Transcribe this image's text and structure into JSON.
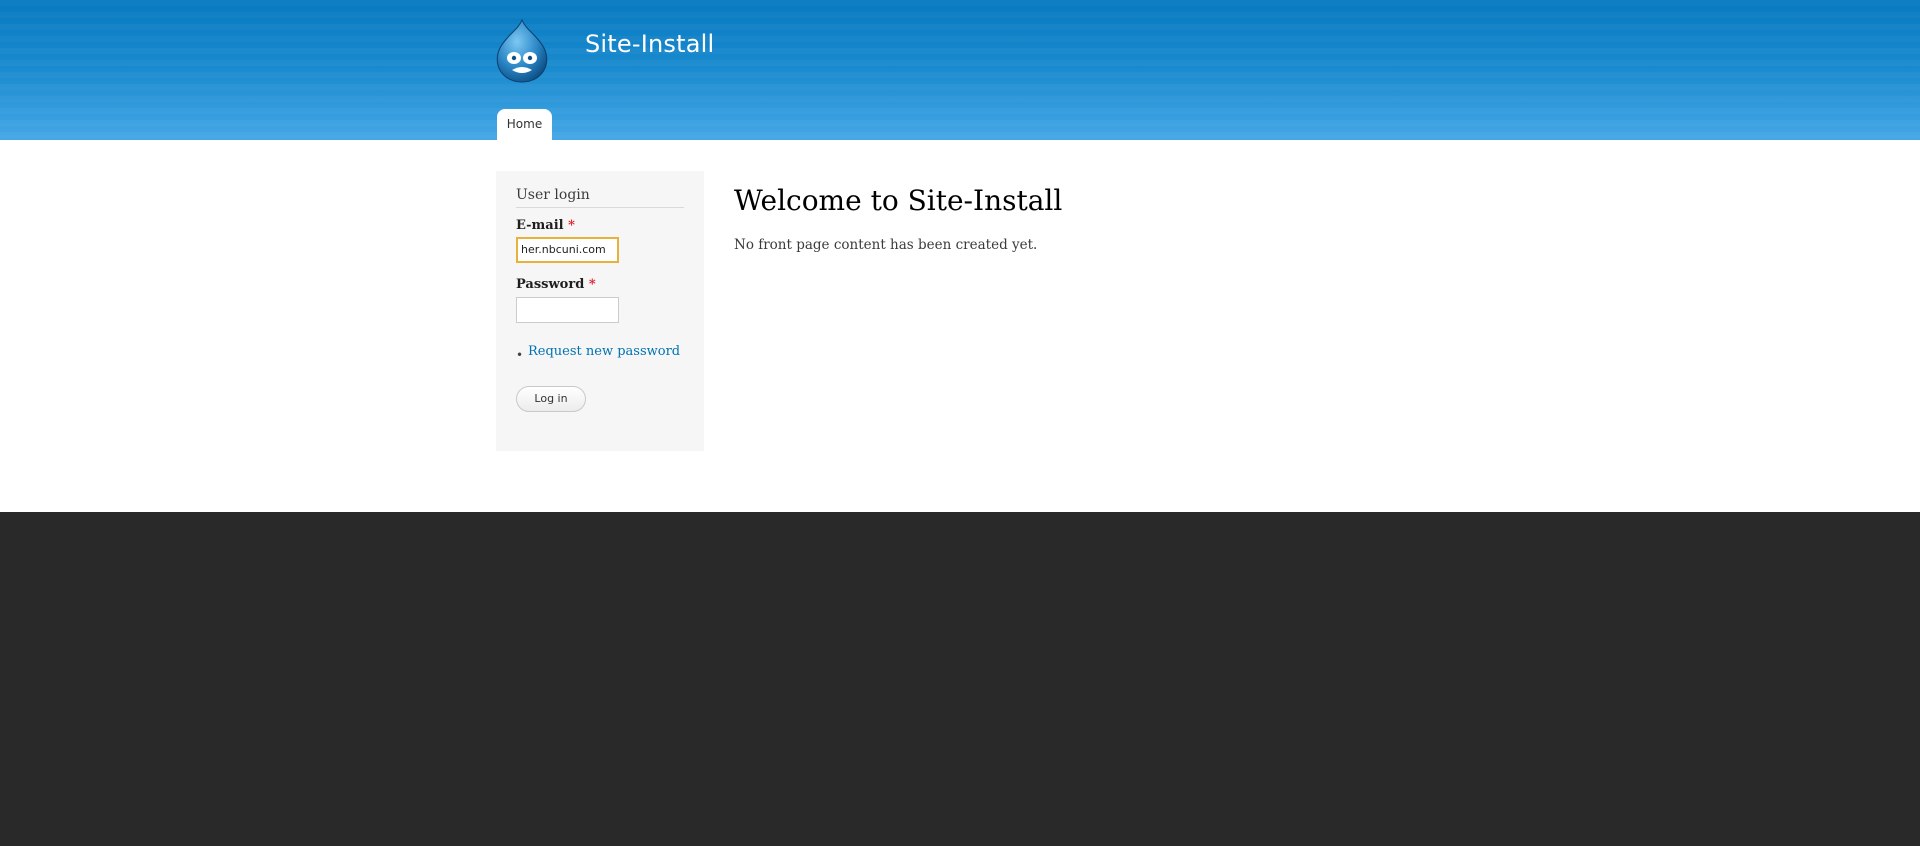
{
  "header": {
    "site_name": "Site-Install",
    "logo_icon": "drupal-drop-logo-icon",
    "nav_tabs": [
      {
        "label": "Home",
        "active": true
      }
    ]
  },
  "sidebar": {
    "block_title": "User login",
    "email": {
      "label": "E-mail",
      "required_marker": "*",
      "value": "her.nbcuni.com"
    },
    "password": {
      "label": "Password",
      "required_marker": "*",
      "value": ""
    },
    "links": [
      "Request new password"
    ],
    "login_button": "Log in"
  },
  "content": {
    "title": "Welcome to Site-Install",
    "text": "No front page content has been created yet."
  },
  "colors": {
    "header_top": "#0779bf",
    "header_bottom": "#45a7e6",
    "link": "#0071b3",
    "required": "#e0202e",
    "focus_border": "#e8b13a",
    "footer": "#292929"
  }
}
